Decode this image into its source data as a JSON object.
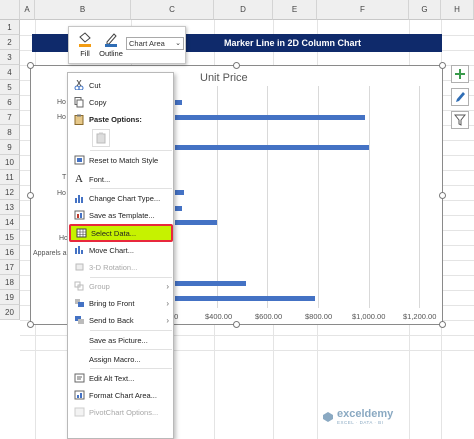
{
  "columns": [
    "A",
    "B",
    "C",
    "D",
    "E",
    "F",
    "G",
    "H"
  ],
  "rows": [
    "1",
    "2",
    "3",
    "4",
    "5",
    "6",
    "7",
    "8",
    "9",
    "10",
    "11",
    "12",
    "13",
    "14",
    "15",
    "16",
    "17",
    "18",
    "19",
    "20"
  ],
  "sheet_title": "Marker Line in 2D Column Chart",
  "chart": {
    "title": "Unit Price",
    "category_labels_visible": [
      "Ho",
      "Ho",
      "T",
      "Ho",
      "Ho",
      "Apparels ar"
    ],
    "x_ticks": [
      "$400.00",
      "$600.00",
      "$800.00",
      "$1,000.00",
      "$1,200.00"
    ],
    "tick_partial": "00",
    "bar_color": "#4472c4"
  },
  "chart_data": {
    "type": "bar",
    "title": "Unit Price",
    "orientation": "horizontal",
    "x_ticks": [
      "$400.00",
      "$600.00",
      "$800.00",
      "$1,000.00",
      "$1,200.00"
    ],
    "xlim": [
      0,
      1200
    ],
    "values_visible": [
      60,
      980,
      1000,
      70,
      60,
      230,
      370,
      590
    ],
    "note_hidden_portion": "left part of chart obscured by context menu"
  },
  "mini_toolbar": {
    "fill_label": "Fill",
    "outline_label": "Outline",
    "chart_element_value": "Chart Area"
  },
  "context_menu": {
    "cut": "Cut",
    "copy": "Copy",
    "paste_options": "Paste Options:",
    "reset_style": "Reset to Match Style",
    "font": "Font...",
    "change_type": "Change Chart Type...",
    "save_template": "Save as Template...",
    "select_data": "Select Data...",
    "move_chart": "Move Chart...",
    "rotation": "3-D Rotation...",
    "group": "Group",
    "bring_front": "Bring to Front",
    "send_back": "Send to Back",
    "save_picture": "Save as Picture...",
    "assign_macro": "Assign Macro...",
    "edit_alt": "Edit Alt Text...",
    "format_area": "Format Chart Area...",
    "pivot_options": "PivotChart Options..."
  },
  "watermark": {
    "name": "exceldemy",
    "tag": "EXCEL · DATA · BI"
  },
  "colors": {
    "accent": "#0f2a6b",
    "highlight": "#c6f200",
    "highlight_border": "#e8283c"
  }
}
